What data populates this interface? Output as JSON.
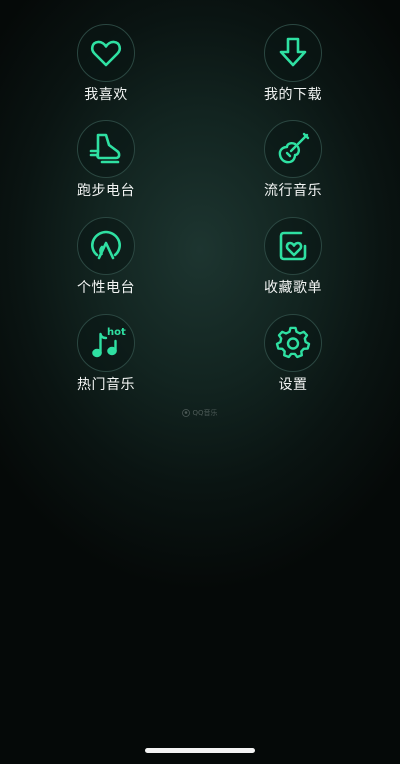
{
  "accent_color": "#2fe0a2",
  "menu": [
    {
      "label": "我喜欢",
      "icon": "heart-icon"
    },
    {
      "label": "我的下载",
      "icon": "download-icon"
    },
    {
      "label": "跑步电台",
      "icon": "running-shoe-icon"
    },
    {
      "label": "流行音乐",
      "icon": "guitar-icon"
    },
    {
      "label": "个性电台",
      "icon": "radio-broadcast-icon"
    },
    {
      "label": "收藏歌单",
      "icon": "playlist-heart-icon"
    },
    {
      "label": "热门音乐",
      "icon": "hot-music-icon",
      "badge": "hot"
    },
    {
      "label": "设置",
      "icon": "settings-gear-icon"
    }
  ],
  "watermark": "QQ音乐"
}
